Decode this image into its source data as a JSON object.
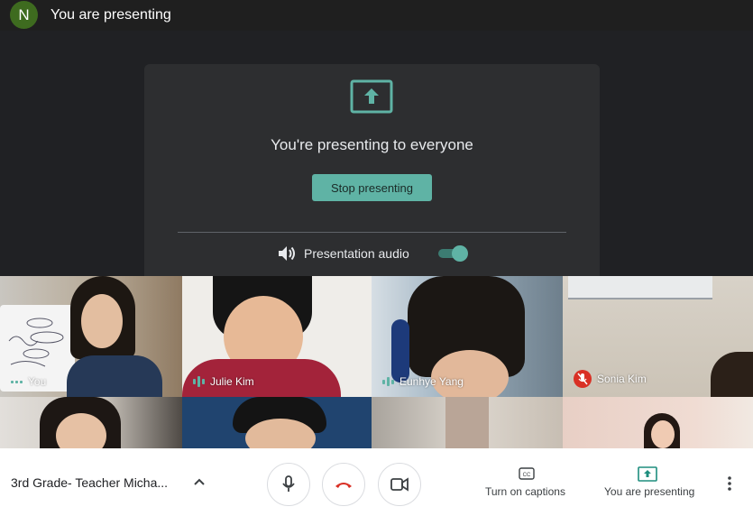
{
  "top_bar": {
    "avatar_initial": "N",
    "title": "You are presenting"
  },
  "presentation_panel": {
    "message": "You're presenting to everyone",
    "stop_label": "Stop presenting",
    "audio_label": "Presentation audio",
    "audio_on": true
  },
  "participants": [
    {
      "name": "You",
      "state": "speaking"
    },
    {
      "name": "Julie Kim",
      "state": "speaking"
    },
    {
      "name": "Eunhye Yang",
      "state": "speaking"
    },
    {
      "name": "Sonia Kim",
      "state": "muted"
    }
  ],
  "bottom_bar": {
    "meeting_title": "3rd Grade- Teacher Micha...",
    "captions_label": "Turn on captions",
    "presenting_label": "You are presenting"
  },
  "colors": {
    "accent": "#5fb3a5",
    "danger": "#d93025",
    "avatar": "#3e6b1f"
  }
}
